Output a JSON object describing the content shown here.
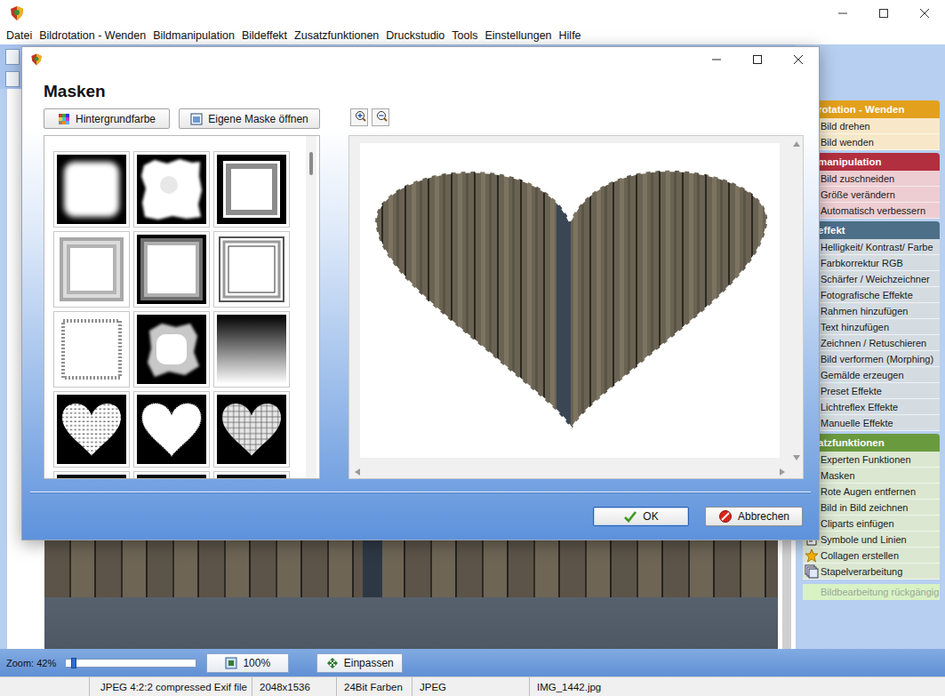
{
  "window": {
    "menu": [
      "Datei",
      "Bildrotation - Wenden",
      "Bildmanipulation",
      "Bildeffekt",
      "Zusatzfunktionen",
      "Druckstudio",
      "Tools",
      "Einstellungen",
      "Hilfe"
    ]
  },
  "dialog": {
    "title": "Masken",
    "background_button": "Hintergrundfarbe",
    "open_button": "Eigene Maske öffnen",
    "masks": [
      {
        "kind": "soft-cloud"
      },
      {
        "kind": "rough-cloud"
      },
      {
        "kind": "frame-black"
      },
      {
        "kind": "frame-grey"
      },
      {
        "kind": "frame-bevel"
      },
      {
        "kind": "frame-double"
      },
      {
        "kind": "leaf-border"
      },
      {
        "kind": "splash"
      },
      {
        "kind": "gradient"
      },
      {
        "kind": "heart-mosaic"
      },
      {
        "kind": "heart-solid"
      },
      {
        "kind": "heart-cells"
      },
      {
        "kind": "dark"
      },
      {
        "kind": "dark"
      },
      {
        "kind": "dark"
      }
    ],
    "ok": "OK",
    "cancel": "Abbrechen"
  },
  "sidebar": {
    "groups": [
      {
        "title": "rotation - Wenden",
        "color": "#e3a01c",
        "items": [
          {
            "label": "Bild drehen",
            "kind": "plain"
          },
          {
            "label": "Bild wenden",
            "kind": "plain"
          }
        ]
      },
      {
        "title": "manipulation",
        "color": "#b22f3f",
        "items": [
          {
            "label": "Bild zuschneiden",
            "kind": "plain"
          },
          {
            "label": "Größe verändern",
            "kind": "plain"
          },
          {
            "label": "Automatisch verbessern",
            "kind": "plain"
          }
        ]
      },
      {
        "title": "effekt",
        "color": "#4d6f88",
        "items": [
          {
            "label": "Helligkeit/ Kontrast/ Farbe",
            "kind": "plain"
          },
          {
            "label": "Farbkorrektur RGB",
            "kind": "plain"
          },
          {
            "label": "Schärfer / Weichzeichner",
            "kind": "plain"
          },
          {
            "label": "Fotografische Effekte",
            "kind": "plain"
          },
          {
            "label": "Rahmen hinzufügen",
            "kind": "plain"
          },
          {
            "label": "Text hinzufügen",
            "kind": "plain"
          },
          {
            "label": "Zeichnen / Retuschieren",
            "kind": "plain"
          },
          {
            "label": "Bild verformen (Morphing)",
            "kind": "plain"
          },
          {
            "label": "Gemälde erzeugen",
            "kind": "plain"
          },
          {
            "label": "Preset Effekte",
            "kind": "plain"
          },
          {
            "label": "Lichtreflex Effekte",
            "kind": "plain"
          },
          {
            "label": "Manuelle Effekte",
            "kind": "plain"
          }
        ]
      },
      {
        "title": "atzfunktionen",
        "color": "#6a9a3e",
        "items": [
          {
            "label": "Experten Funktionen",
            "kind": "plain"
          },
          {
            "label": "Masken",
            "kind": "plain"
          },
          {
            "label": "Rote Augen entfernen",
            "kind": "plain"
          },
          {
            "label": "Bild in Bild zeichnen",
            "kind": "plain"
          },
          {
            "label": "Cliparts einfügen",
            "kind": "plain"
          },
          {
            "label": "Symbole und Linien",
            "kind": "symbols"
          },
          {
            "label": "Collagen erstellen",
            "kind": "collage"
          },
          {
            "label": "Stapelverarbeitung",
            "kind": "batch"
          }
        ]
      }
    ],
    "undo": {
      "label": "Bildbearbeitung rückgängig",
      "disabled": true
    }
  },
  "zoom": {
    "label": "Zoom: 42%",
    "level": 0.04,
    "buttons": [
      {
        "label": "100%",
        "kind": "actual"
      },
      {
        "label": "Einpassen",
        "kind": "fit"
      }
    ]
  },
  "status_bar": [
    "JPEG 4:2:2 compressed Exif file",
    "2048x1536",
    "24Bit Farben",
    "JPEG",
    "IMG_1442.jpg"
  ]
}
